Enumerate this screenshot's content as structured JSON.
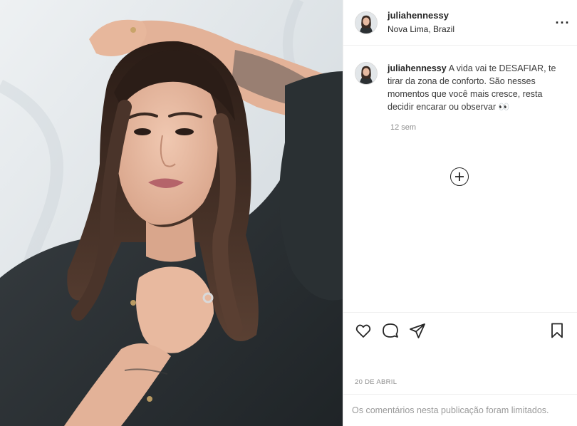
{
  "post": {
    "author": {
      "username": "juliahennessy",
      "location": "Nova Lima, Brazil"
    },
    "caption": {
      "username": "juliahennessy",
      "text": "A vida vai te DESAFIAR, te tirar da zona de conforto. São nesses momentos que você mais cresce, resta decidir encarar ou observar 👀",
      "age": "12 sem"
    },
    "date": "20 DE ABRIL",
    "comments_notice": "Os comentários nesta publicação foram limitados.",
    "more_label": "···"
  },
  "icons": {
    "more": "more-options-icon",
    "load_more": "plus-circle-icon",
    "like": "heart-icon",
    "comment": "comment-icon",
    "share": "paper-plane-icon",
    "save": "bookmark-icon"
  },
  "colors": {
    "text": "#262626",
    "muted": "#8e8e8e",
    "border": "#efefef",
    "jacket": "#2b3033",
    "hair": "#3a2a22",
    "skin": "#e6b9a0",
    "backdrop": "#d9dfe3"
  }
}
